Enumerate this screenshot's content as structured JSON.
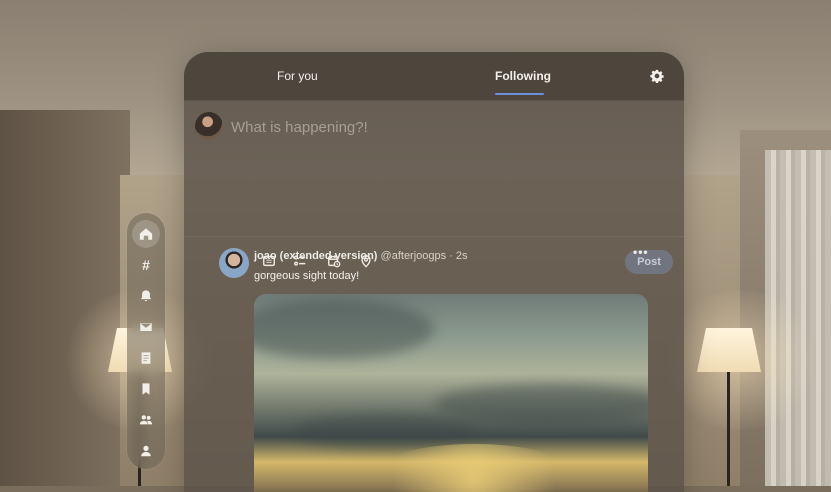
{
  "tabs": {
    "for_you": "For you",
    "following": "Following",
    "active": "Following"
  },
  "composer": {
    "placeholder": "What is happening?!",
    "post_label": "Post"
  },
  "icons": {
    "nav": [
      "home-icon",
      "hash-icon",
      "bell-icon",
      "mail-icon",
      "list-icon",
      "bookmark-icon",
      "people-icon",
      "profile-icon"
    ],
    "composer_tools": [
      "image-icon",
      "gif-icon",
      "poll-icon",
      "schedule-icon",
      "location-icon"
    ],
    "settings": "gear-icon",
    "more": "more-icon"
  },
  "post": {
    "name": "joao (extended version)",
    "handle": "@afterjoogps",
    "time": "· 2s",
    "text": "gorgeous sight today!"
  },
  "colors": {
    "accent": "#6b8fd8",
    "post_button": "#7887a5"
  }
}
